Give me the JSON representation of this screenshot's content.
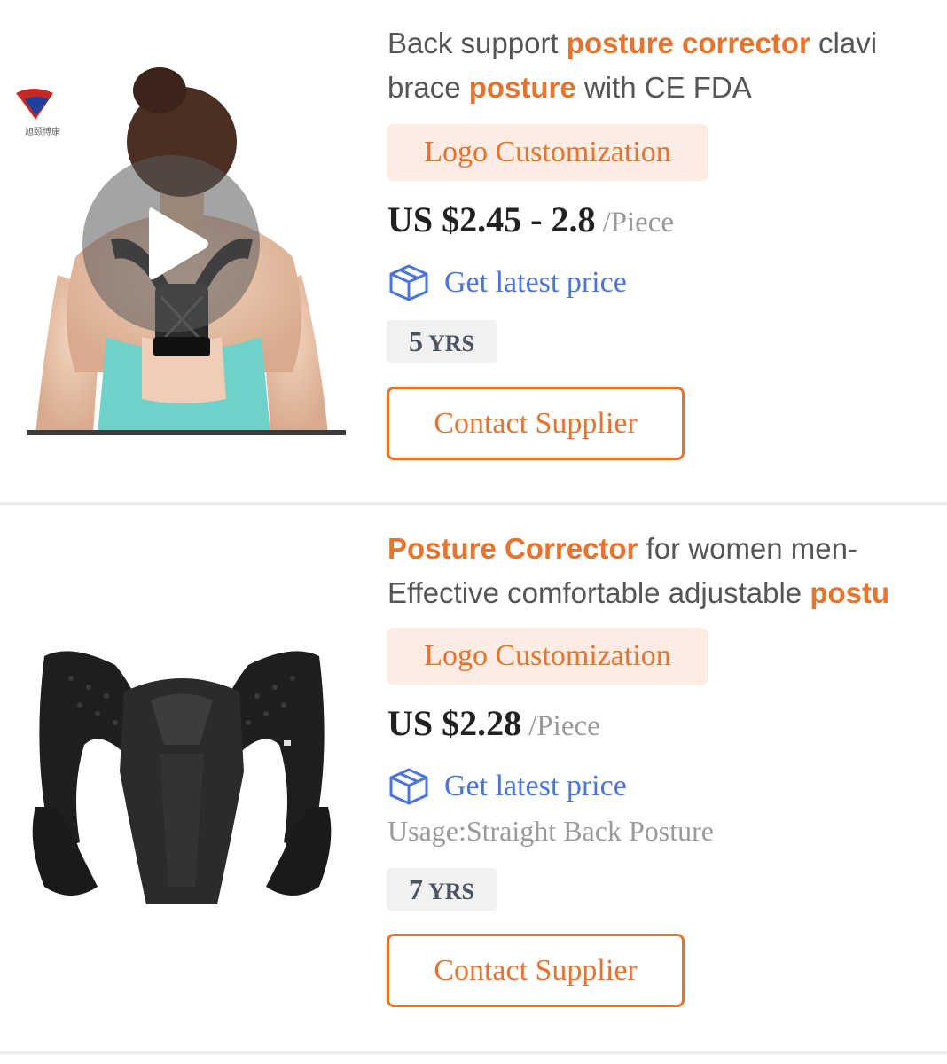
{
  "products": [
    {
      "title_segments": [
        {
          "text": "Back support ",
          "highlight": false
        },
        {
          "text": "posture corrector",
          "highlight": true
        },
        {
          "text": " clavi",
          "highlight": false
        }
      ],
      "title_line2_segments": [
        {
          "text": "brace ",
          "highlight": false
        },
        {
          "text": "posture",
          "highlight": true
        },
        {
          "text": " with CE FDA",
          "highlight": false
        }
      ],
      "tag": "Logo Customization",
      "price": "US $2.45 - 2.8",
      "unit": "/Piece",
      "latest_price": "Get latest price",
      "years_num": "5",
      "years_unit": "YRS",
      "contact": "Contact Supplier",
      "image": "woman-wearing-posture-corrector-video",
      "has_video": true
    },
    {
      "title_segments": [
        {
          "text": "Posture Corrector",
          "highlight": true
        },
        {
          "text": " for women men-",
          "highlight": false
        }
      ],
      "title_line2_segments": [
        {
          "text": "Effective comfortable adjustable ",
          "highlight": false
        },
        {
          "text": "postu",
          "highlight": true
        }
      ],
      "tag": "Logo Customization",
      "price": "US $2.28",
      "unit": "/Piece",
      "latest_price": "Get latest price",
      "usage": "Usage:Straight Back Posture",
      "years_num": "7",
      "years_unit": "YRS",
      "contact": "Contact Supplier",
      "image": "black-posture-corrector-brace",
      "has_video": false
    }
  ],
  "colors": {
    "accent": "#e8732d",
    "tag_bg": "#fdece3",
    "link": "#4a74e0",
    "price": "#222222",
    "muted": "#999999"
  },
  "icons": {
    "latest_price": "box-icon",
    "video": "play-icon"
  }
}
